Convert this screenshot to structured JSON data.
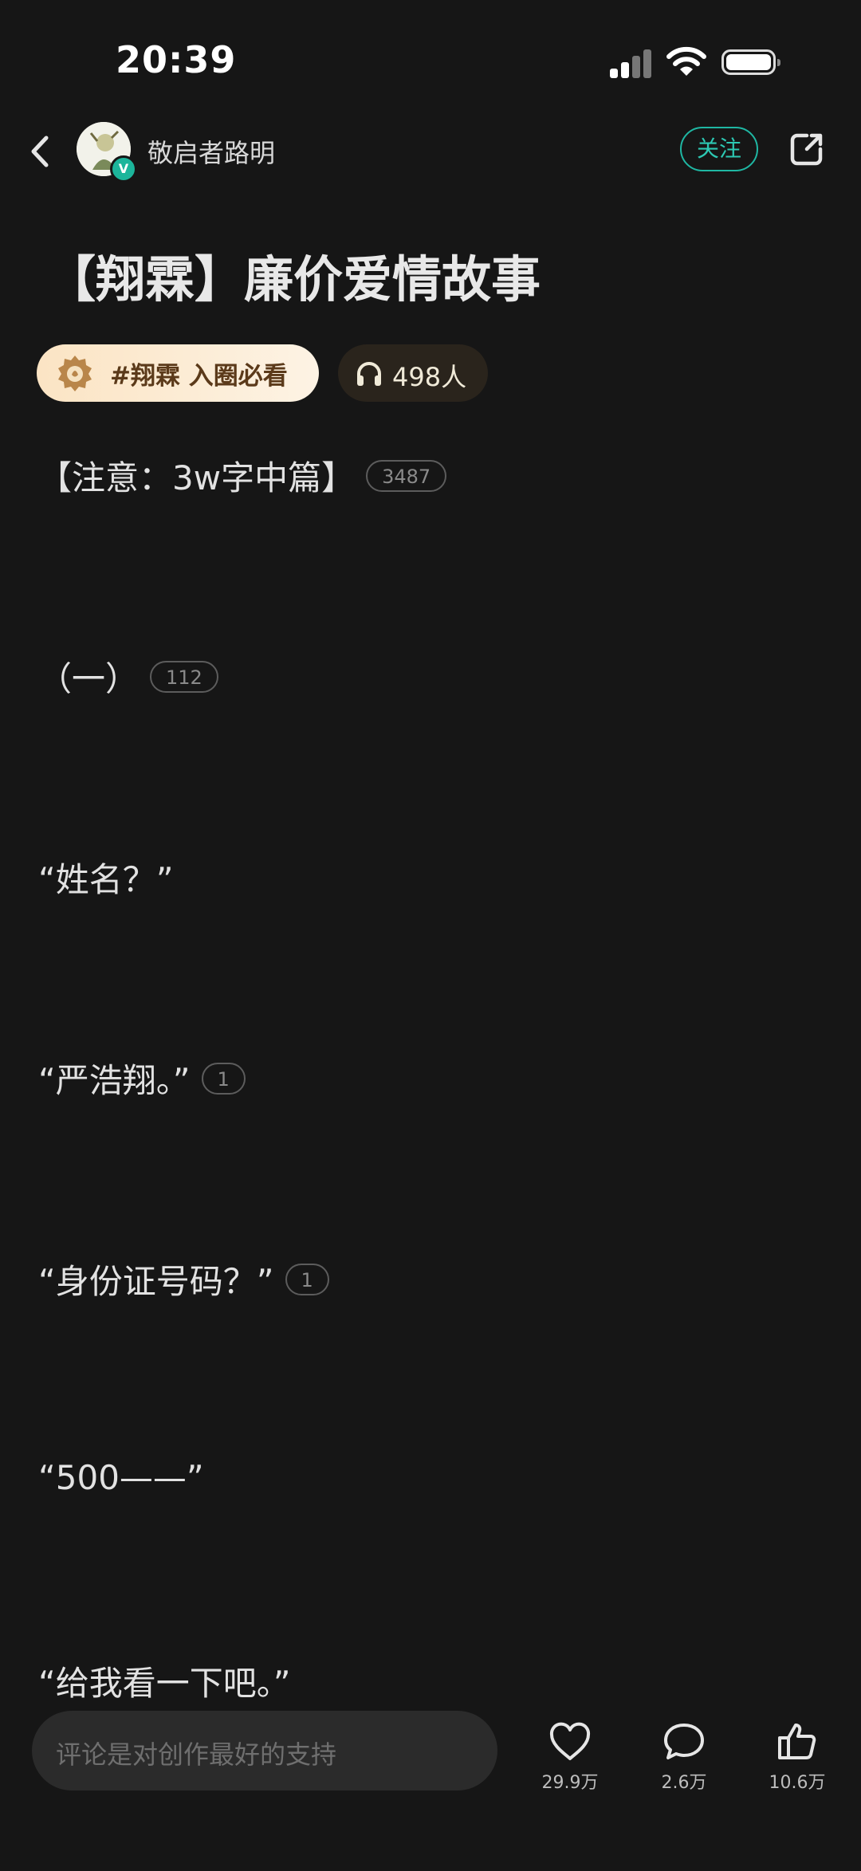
{
  "status_bar": {
    "time": "20:39"
  },
  "header": {
    "author_name": "敬启者路明",
    "follow_label": "关注",
    "avatar_badge": "V"
  },
  "article": {
    "title": "【翔霖】廉价爱情故事",
    "topic_tag": "#翔霖 入圈必看",
    "listeners": "498人",
    "paragraphs": [
      {
        "text": "【注意：3w字中篇】",
        "comments": "3487"
      },
      {
        "text": "（一）",
        "comments": "112"
      },
      {
        "text": "“姓名？”",
        "comments": ""
      },
      {
        "text": "“严浩翔。”",
        "comments": "1"
      },
      {
        "text": "“身份证号码？”",
        "comments": "1"
      },
      {
        "text": "“500——”",
        "comments": ""
      },
      {
        "text": "“给我看一下吧。”",
        "comments": ""
      }
    ]
  },
  "bottom_bar": {
    "comment_placeholder": "评论是对创作最好的支持",
    "likes": "29.9万",
    "comments": "2.6万",
    "thumbs": "10.6万"
  },
  "icons": [
    "back-arrow-icon",
    "verified-badge-icon",
    "share-icon",
    "topic-badge-icon",
    "headphones-icon",
    "heart-icon",
    "comment-bubble-icon",
    "thumbs-up-icon"
  ],
  "colors": {
    "background": "#161616",
    "accent": "#1fb7a3",
    "tag_bg": "#fbe4c4"
  }
}
